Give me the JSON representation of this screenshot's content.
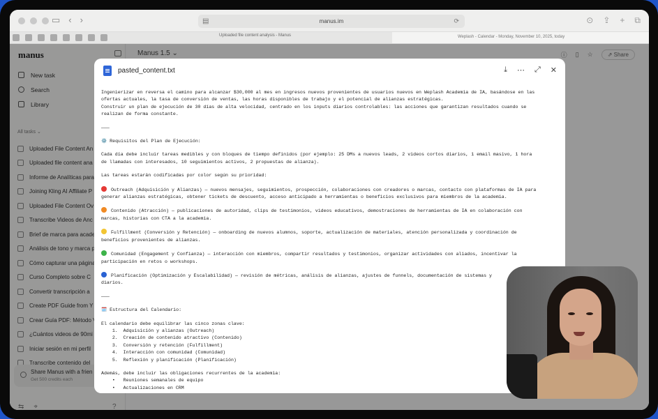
{
  "browser": {
    "url": "manus.im",
    "tabs": [
      {
        "title": "Uploaded file content analysis - Manus"
      },
      {
        "title": "Weplash - Calendar - Monday, November 10, 2025, today"
      }
    ]
  },
  "sidebar": {
    "brand": "manus",
    "nav": [
      {
        "label": "New task",
        "icon": "pencil-icon"
      },
      {
        "label": "Search",
        "icon": "search-icon"
      },
      {
        "label": "Library",
        "icon": "library-icon"
      }
    ],
    "section_label": "All tasks ⌄",
    "tasks": [
      "Uploaded File Content An",
      "Uploaded file content ana",
      "Informe de Analíticas para",
      "Joining Kling AI Affiliate P",
      "Uploaded File Content Ov",
      "Transcribe Videos de Anc",
      "Brief de marca para acade",
      "Análisis de tono y marca p",
      "Cómo capturar una página",
      "Curso Completo sobre C",
      "Convertir transcripción a",
      "Create PDF Guide from Y",
      "Crear Guía PDF: Método V",
      "¿Cuántos videos de 90mi",
      "Iniciar sesión en mi perfil",
      "Transcribe contenido del"
    ],
    "share": {
      "title": "Share Manus with a frien",
      "subtitle": "Get 500 credits each"
    }
  },
  "main": {
    "model": "Manus 1.5 ⌄",
    "share_label": "Share"
  },
  "modal": {
    "filename": "pasted_content.txt",
    "lines": [
      "Ingenierizar en reversa el camino para alcanzar $30,000 al mes en ingresos nuevos provenientes de usuarios nuevos en Weplash Academia de IA, basándose en las",
      "ofertas actuales, la tasa de conversión de ventas, las horas disponibles de trabajo y el potencial de alianzas estratégicas.",
      "Construir un plan de ejecución de 30 días de alta velocidad, centrado en los inputs diarios controlables: las acciones que garantizan resultados cuando se",
      "realizan de forma constante.",
      "",
      "———",
      "",
      "⚙️ Requisitos del Plan de Ejecución:",
      "",
      "Cada día debe incluir tareas medibles y con bloques de tiempo definidos (por ejemplo: 25 DMs a nuevos leads, 2 videos cortos diarios, 1 email masivo, 1 hora",
      "de llamadas con interesados, 10 seguimientos activos, 2 propuestas de alianza).",
      "",
      "Las tareas estarán codificadas por color según su prioridad:",
      "",
      "🔴 Outreach (Adquisición y Alianzas) — nuevos mensajes, seguimientos, prospección, colaboraciones con creadores o marcas, contacto con plataformas de IA para",
      "generar alianzas estratégicas, obtener tickets de descuento, acceso anticipado a herramientas o beneficios exclusivos para miembros de la academia.",
      "",
      "🟠 Contenido (Atracción) — publicaciones de autoridad, clips de testimonios, videos educativos, demostraciones de herramientas de IA en colaboración con",
      "marcas, historias con CTA a la academia.",
      "",
      "🟡 Fulfillment (Conversión y Retención) — onboarding de nuevos alumnos, soporte, actualización de materiales, atención personalizada y coordinación de",
      "beneficios provenientes de alianzas.",
      "",
      "🟢 Comunidad (Engagement y Confianza) — interacción con miembros, compartir resultados y testimonios, organizar actividades con aliados, incentivar la",
      "participación en retos o workshops.",
      "",
      "🔵 Planificación (Optimización y Escalabilidad) — revisión de métricas, análisis de alianzas, ajustes de funnels, documentación de sistemas y",
      "diarios.",
      "",
      "———",
      "",
      "🗓️ Estructura del Calendario:",
      "",
      "El calendario debe equilibrar las cinco zonas clave:",
      "    1.  Adquisición y alianzas (Outreach)",
      "    2.  Creación de contenido atractivo (Contenido)",
      "    3.  Conversión y retención (Fulfillment)",
      "    4.  Interacción con comunidad (Comunidad)",
      "    5.  Reflexión y planificación (Planificación)",
      "",
      "Además, debe incluir las obligaciones recurrentes de la academia:",
      "    •   Reuniones semanales de equipo",
      "    •   Actualizaciones en CRM"
    ]
  }
}
